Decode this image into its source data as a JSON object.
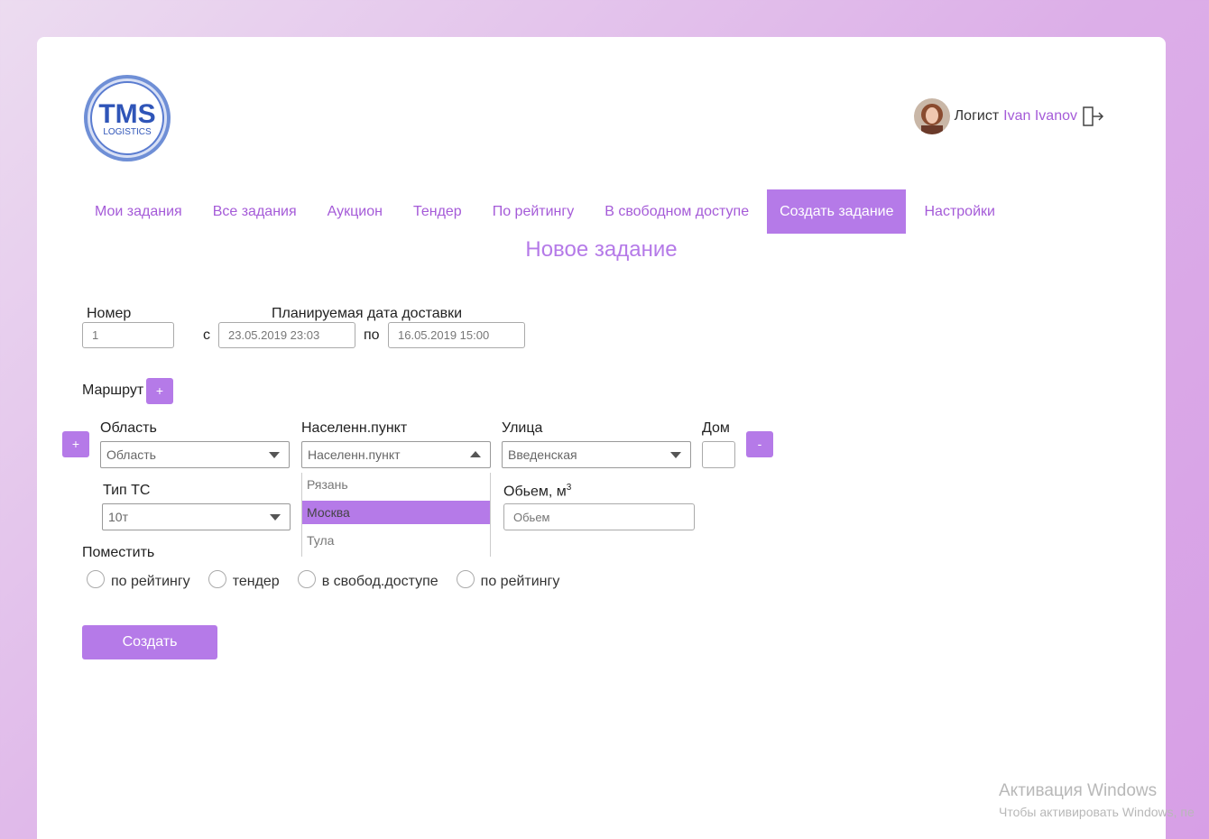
{
  "brand": {
    "logo_text": "TMS",
    "logo_sub": "LOGISTICS"
  },
  "user": {
    "role": "Логист",
    "name": "Ivan Ivanov"
  },
  "nav": [
    {
      "label": "Мои задания"
    },
    {
      "label": "Все задания"
    },
    {
      "label": "Аукцион"
    },
    {
      "label": "Тендер"
    },
    {
      "label": "По рейтингу"
    },
    {
      "label": "В свободном доступе"
    },
    {
      "label": "Создать задание"
    },
    {
      "label": "Настройки"
    }
  ],
  "page_title": "Новое задание",
  "form": {
    "number_label": "Номер",
    "number_value": "1",
    "date_label": "Планируемая дата доставки",
    "from_label": "с",
    "from_value": "23.05.2019 23:03",
    "to_label": "по",
    "to_value": "16.05.2019 15:00",
    "route_label": "Маршрут",
    "plus": "+",
    "minus": "-",
    "region_label": "Область",
    "region_value": "Область",
    "city_label": "Населенн.пункт",
    "city_value": "Населенн.пункт",
    "street_label": "Улица",
    "street_value": "Введенская",
    "house_label": "Дом",
    "vehicle_label": "Тип ТС",
    "vehicle_value": "10т",
    "volume_label": "Обьем, м",
    "volume_sup": "3",
    "volume_placeholder": "Обьем",
    "city_options": [
      "Рязань",
      "Москва",
      "Тула"
    ],
    "place_label": "Поместить",
    "place_options": [
      "по рейтингу",
      "тендер",
      "в свобод.доступе",
      "по рейтингу"
    ],
    "submit_label": "Создать"
  },
  "watermark": {
    "line1": "Активация Windows",
    "line2": "Чтобы активировать Windows, пе"
  }
}
